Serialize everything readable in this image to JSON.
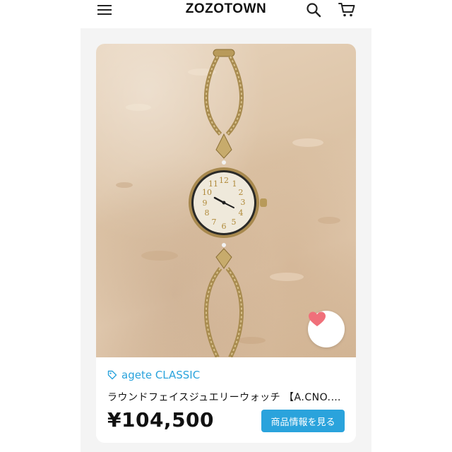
{
  "header": {
    "logo": "ZOZOTOWN",
    "menu_icon": "hamburger-menu-icon",
    "search_icon": "search-icon",
    "cart_icon": "cart-icon"
  },
  "product": {
    "image_icon": "wristwatch-photo",
    "favorite_icon": "heart-icon",
    "favorite_color": "#f0707a",
    "brand_icon": "tag-icon",
    "brand": "agete CLASSIC",
    "title": "ラウンドフェイスジュエリーウォッチ 【A.CNO.…",
    "price": "¥104,500",
    "detail_button": "商品情報を見る"
  },
  "colors": {
    "accent": "#2aa3dc",
    "background": "#f4f4f4"
  }
}
